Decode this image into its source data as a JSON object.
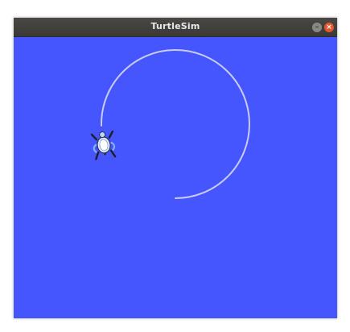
{
  "window": {
    "title": "TurtleSim",
    "controls": {
      "minimize_icon": "minimize-icon",
      "close_icon": "close-icon"
    }
  },
  "canvas": {
    "background_color": "#4556ff",
    "trail_color": "#c8ccff",
    "turtle_icon": "turtle-icon"
  }
}
